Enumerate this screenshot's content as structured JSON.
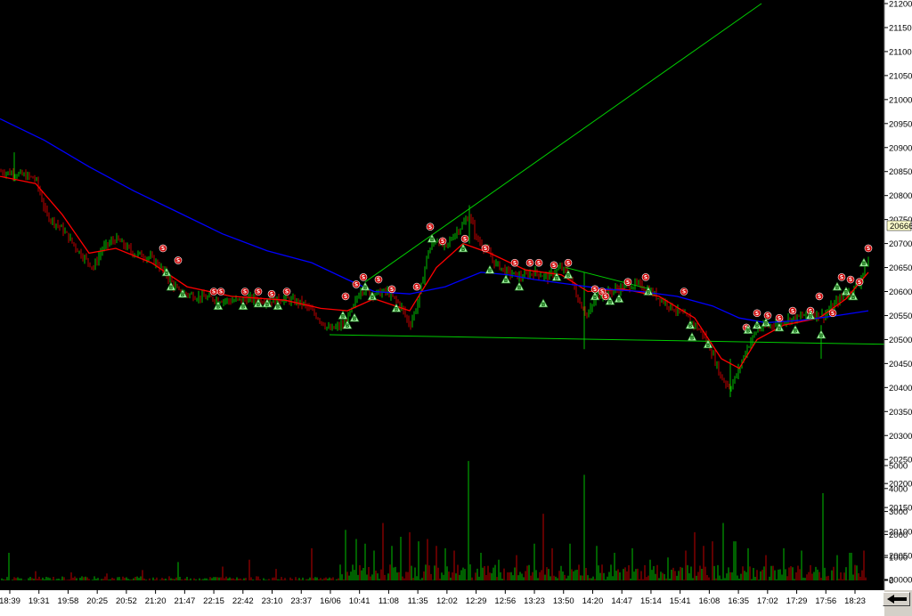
{
  "chart_data": {
    "type": "candlestick",
    "grid": false,
    "background": "#000000",
    "price_axis": {
      "range": [
        20000,
        21200
      ],
      "ticks": [
        "21200",
        "21150",
        "21100",
        "21050",
        "21000",
        "20950",
        "20900",
        "20850",
        "20800",
        "20750",
        "20700",
        "20650",
        "20600",
        "20550",
        "20500",
        "20450",
        "20400",
        "20350",
        "20300",
        "20250",
        "20200",
        "20150",
        "20100",
        "20050",
        "20000"
      ],
      "last_price": "20666"
    },
    "volume_axis": {
      "range": [
        0,
        5800
      ],
      "ticks": [
        "5000",
        "4000",
        "3000",
        "2000",
        "1000",
        "0"
      ]
    },
    "time_axis": {
      "labels": [
        "18:39",
        "19:31",
        "19:58",
        "20:25",
        "20:52",
        "21:20",
        "21:47",
        "22:15",
        "22:42",
        "23:10",
        "23:37",
        "16/06",
        "10:41",
        "11:08",
        "11:35",
        "12:02",
        "12:29",
        "12:56",
        "13:23",
        "13:50",
        "14:20",
        "14:47",
        "15:14",
        "15:41",
        "16:08",
        "16:35",
        "17:02",
        "17:29",
        "17:56",
        "18:23"
      ]
    },
    "price_path": [
      [
        0,
        20850
      ],
      [
        20,
        20845
      ],
      [
        40,
        20835
      ],
      [
        52,
        20760
      ],
      [
        70,
        20730
      ],
      [
        90,
        20680
      ],
      [
        105,
        20650
      ],
      [
        115,
        20690
      ],
      [
        130,
        20710
      ],
      [
        150,
        20680
      ],
      [
        170,
        20670
      ],
      [
        185,
        20640
      ],
      [
        200,
        20600
      ],
      [
        220,
        20590
      ],
      [
        240,
        20585
      ],
      [
        260,
        20580
      ],
      [
        280,
        20585
      ],
      [
        300,
        20580
      ],
      [
        320,
        20585
      ],
      [
        340,
        20575
      ],
      [
        355,
        20550
      ],
      [
        370,
        20520
      ],
      [
        385,
        20530
      ],
      [
        395,
        20560
      ],
      [
        405,
        20605
      ],
      [
        420,
        20595
      ],
      [
        435,
        20600
      ],
      [
        450,
        20570
      ],
      [
        460,
        20530
      ],
      [
        470,
        20580
      ],
      [
        480,
        20680
      ],
      [
        490,
        20710
      ],
      [
        500,
        20690
      ],
      [
        510,
        20720
      ],
      [
        520,
        20740
      ],
      [
        527,
        20760
      ],
      [
        535,
        20710
      ],
      [
        545,
        20690
      ],
      [
        555,
        20660
      ],
      [
        570,
        20640
      ],
      [
        585,
        20630
      ],
      [
        600,
        20640
      ],
      [
        615,
        20630
      ],
      [
        630,
        20650
      ],
      [
        640,
        20630
      ],
      [
        650,
        20580
      ],
      [
        660,
        20550
      ],
      [
        670,
        20590
      ],
      [
        685,
        20600
      ],
      [
        700,
        20610
      ],
      [
        715,
        20615
      ],
      [
        730,
        20600
      ],
      [
        745,
        20580
      ],
      [
        760,
        20560
      ],
      [
        775,
        20540
      ],
      [
        790,
        20510
      ],
      [
        800,
        20470
      ],
      [
        810,
        20420
      ],
      [
        820,
        20400
      ],
      [
        828,
        20430
      ],
      [
        838,
        20480
      ],
      [
        850,
        20520
      ],
      [
        865,
        20530
      ],
      [
        880,
        20540
      ],
      [
        895,
        20545
      ],
      [
        910,
        20555
      ],
      [
        925,
        20550
      ],
      [
        940,
        20580
      ],
      [
        955,
        20600
      ],
      [
        965,
        20620
      ],
      [
        975,
        20666
      ]
    ],
    "series": [
      {
        "name": "",
        "color": "#ff0000",
        "points": [
          [
            0,
            20840
          ],
          [
            40,
            20825
          ],
          [
            70,
            20760
          ],
          [
            100,
            20680
          ],
          [
            130,
            20690
          ],
          [
            170,
            20660
          ],
          [
            210,
            20610
          ],
          [
            260,
            20590
          ],
          [
            320,
            20582
          ],
          [
            360,
            20565
          ],
          [
            390,
            20560
          ],
          [
            420,
            20585
          ],
          [
            460,
            20560
          ],
          [
            490,
            20650
          ],
          [
            520,
            20700
          ],
          [
            550,
            20680
          ],
          [
            590,
            20645
          ],
          [
            630,
            20635
          ],
          [
            660,
            20600
          ],
          [
            700,
            20605
          ],
          [
            740,
            20590
          ],
          [
            780,
            20545
          ],
          [
            810,
            20460
          ],
          [
            830,
            20440
          ],
          [
            850,
            20500
          ],
          [
            880,
            20530
          ],
          [
            920,
            20545
          ],
          [
            950,
            20585
          ],
          [
            975,
            20640
          ]
        ]
      },
      {
        "name": "",
        "color": "#0000ff",
        "points": [
          [
            0,
            20960
          ],
          [
            50,
            20915
          ],
          [
            100,
            20860
          ],
          [
            150,
            20810
          ],
          [
            200,
            20765
          ],
          [
            250,
            20720
          ],
          [
            300,
            20685
          ],
          [
            350,
            20660
          ],
          [
            390,
            20625
          ],
          [
            420,
            20600
          ],
          [
            460,
            20595
          ],
          [
            500,
            20610
          ],
          [
            540,
            20640
          ],
          [
            570,
            20635
          ],
          [
            600,
            20625
          ],
          [
            640,
            20615
          ],
          [
            680,
            20605
          ],
          [
            720,
            20600
          ],
          [
            760,
            20590
          ],
          [
            800,
            20570
          ],
          [
            830,
            20545
          ],
          [
            860,
            20535
          ],
          [
            900,
            20540
          ],
          [
            940,
            20550
          ],
          [
            975,
            20560
          ]
        ]
      }
    ],
    "trendlines": [
      {
        "color": "#00cc00",
        "from": [
          410,
          20620
        ],
        "to": [
          855,
          21200
        ]
      },
      {
        "color": "#00cc00",
        "from": [
          635,
          20650
        ],
        "to": [
          730,
          20605
        ]
      },
      {
        "color": "#00cc00",
        "from": [
          370,
          20510
        ],
        "to": [
          995,
          20490
        ]
      }
    ],
    "sell_signals": [
      [
        183,
        20690
      ],
      [
        200,
        20665
      ],
      [
        240,
        20600
      ],
      [
        248,
        20600
      ],
      [
        275,
        20600
      ],
      [
        290,
        20600
      ],
      [
        305,
        20595
      ],
      [
        322,
        20600
      ],
      [
        388,
        20590
      ],
      [
        400,
        20615
      ],
      [
        408,
        20630
      ],
      [
        425,
        20625
      ],
      [
        440,
        20605
      ],
      [
        468,
        20610
      ],
      [
        483,
        20735
      ],
      [
        497,
        20705
      ],
      [
        522,
        20710
      ],
      [
        545,
        20690
      ],
      [
        578,
        20660
      ],
      [
        595,
        20660
      ],
      [
        605,
        20660
      ],
      [
        622,
        20655
      ],
      [
        638,
        20660
      ],
      [
        668,
        20605
      ],
      [
        676,
        20600
      ],
      [
        680,
        20590
      ],
      [
        705,
        20620
      ],
      [
        725,
        20630
      ],
      [
        768,
        20600
      ],
      [
        838,
        20525
      ],
      [
        850,
        20555
      ],
      [
        862,
        20550
      ],
      [
        875,
        20545
      ],
      [
        890,
        20560
      ],
      [
        910,
        20560
      ],
      [
        920,
        20590
      ],
      [
        935,
        20555
      ],
      [
        945,
        20630
      ],
      [
        955,
        20625
      ],
      [
        965,
        20620
      ],
      [
        975,
        20690
      ]
    ],
    "buy_signals": [
      [
        187,
        20640
      ],
      [
        192,
        20610
      ],
      [
        205,
        20595
      ],
      [
        245,
        20570
      ],
      [
        273,
        20570
      ],
      [
        290,
        20575
      ],
      [
        300,
        20575
      ],
      [
        312,
        20570
      ],
      [
        385,
        20550
      ],
      [
        390,
        20530
      ],
      [
        398,
        20545
      ],
      [
        410,
        20610
      ],
      [
        418,
        20590
      ],
      [
        445,
        20565
      ],
      [
        485,
        20710
      ],
      [
        520,
        20690
      ],
      [
        550,
        20645
      ],
      [
        568,
        20625
      ],
      [
        583,
        20610
      ],
      [
        610,
        20575
      ],
      [
        625,
        20630
      ],
      [
        638,
        20635
      ],
      [
        668,
        20590
      ],
      [
        685,
        20580
      ],
      [
        695,
        20585
      ],
      [
        728,
        20600
      ],
      [
        775,
        20530
      ],
      [
        777,
        20505
      ],
      [
        795,
        20490
      ],
      [
        840,
        20520
      ],
      [
        850,
        20530
      ],
      [
        860,
        20535
      ],
      [
        875,
        20525
      ],
      [
        893,
        20520
      ],
      [
        910,
        20550
      ],
      [
        922,
        20510
      ],
      [
        940,
        20610
      ],
      [
        950,
        20600
      ],
      [
        958,
        20590
      ],
      [
        970,
        20660
      ]
    ],
    "volume_bars": [
      [
        10,
        1200
      ],
      [
        40,
        400
      ],
      [
        80,
        350
      ],
      [
        120,
        300
      ],
      [
        160,
        450
      ],
      [
        200,
        800
      ],
      [
        250,
        600
      ],
      [
        280,
        900
      ],
      [
        310,
        500
      ],
      [
        350,
        1400
      ],
      [
        388,
        2200
      ],
      [
        400,
        1800
      ],
      [
        410,
        1600
      ],
      [
        420,
        1300
      ],
      [
        430,
        2500
      ],
      [
        440,
        1500
      ],
      [
        450,
        1900
      ],
      [
        460,
        2100
      ],
      [
        470,
        1700
      ],
      [
        480,
        1800
      ],
      [
        490,
        1500
      ],
      [
        500,
        1400
      ],
      [
        510,
        1300
      ],
      [
        526,
        5200
      ],
      [
        540,
        1200
      ],
      [
        560,
        900
      ],
      [
        580,
        1100
      ],
      [
        600,
        1600
      ],
      [
        610,
        2900
      ],
      [
        620,
        1400
      ],
      [
        640,
        1600
      ],
      [
        656,
        4600
      ],
      [
        670,
        1500
      ],
      [
        690,
        1200
      ],
      [
        710,
        1400
      ],
      [
        730,
        900
      ],
      [
        750,
        1000
      ],
      [
        770,
        1300
      ],
      [
        780,
        2100
      ],
      [
        790,
        1500
      ],
      [
        800,
        1700
      ],
      [
        812,
        2500
      ],
      [
        825,
        1700
      ],
      [
        840,
        1400
      ],
      [
        860,
        1100
      ],
      [
        880,
        1400
      ],
      [
        900,
        1300
      ],
      [
        924,
        3800
      ],
      [
        940,
        1100
      ],
      [
        955,
        1200
      ],
      [
        970,
        1300
      ]
    ]
  },
  "ui": {
    "scroll_button_icon": "left-arrow-icon"
  }
}
